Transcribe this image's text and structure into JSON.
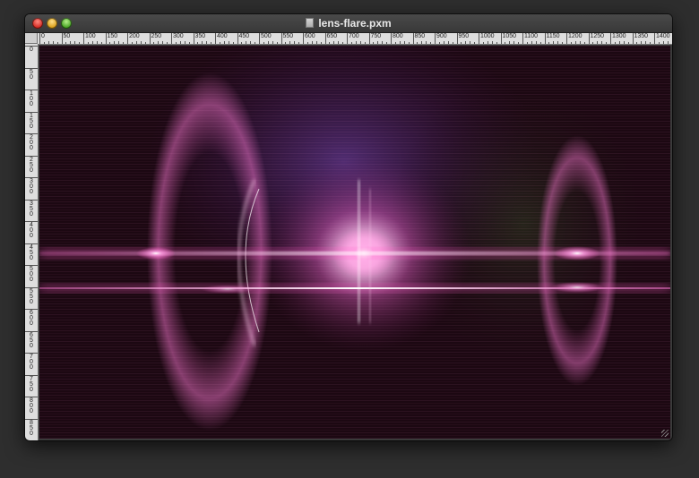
{
  "window": {
    "title": "lens-flare.pxm",
    "buttons": {
      "close": "close",
      "minimize": "minimize",
      "zoom": "zoom"
    }
  },
  "ruler": {
    "horizontal_labels": [
      "0",
      "50",
      "100",
      "150",
      "200",
      "250",
      "300",
      "350",
      "400",
      "450",
      "500",
      "550",
      "600",
      "650",
      "700",
      "750",
      "800",
      "850",
      "900",
      "950",
      "1000",
      "1050",
      "1100",
      "1150",
      "1200",
      "1250",
      "1300",
      "1350",
      "1400"
    ],
    "vertical_labels": [
      "0",
      "50",
      "100",
      "150",
      "200",
      "250",
      "300",
      "350",
      "400",
      "450",
      "500",
      "550",
      "600",
      "650",
      "700",
      "750",
      "800",
      "850"
    ]
  },
  "image": {
    "name": "lens flare",
    "colors": {
      "background": "#1c0812",
      "flare": "#ff7ad6",
      "core": "#ffffff",
      "violet": "#6b3fa0"
    }
  }
}
